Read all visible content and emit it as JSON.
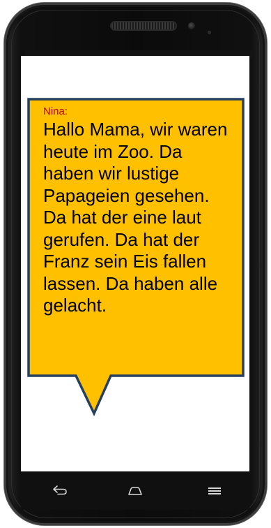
{
  "message": {
    "sender": "Nina:",
    "text": "Hallo Mama, wir waren heute im Zoo. Da haben wir lustige Papageien gesehen. Da hat der eine laut gerufen. Da hat der Franz sein Eis fallen lassen. Da haben alle gelacht."
  },
  "navbar": {
    "back_icon": "back-arrow-icon",
    "home_icon": "home-icon",
    "menu_icon": "menu-icon"
  },
  "colors": {
    "bubble_fill": "#FFC000",
    "bubble_border": "#243F60",
    "sender_text": "#C00000"
  }
}
